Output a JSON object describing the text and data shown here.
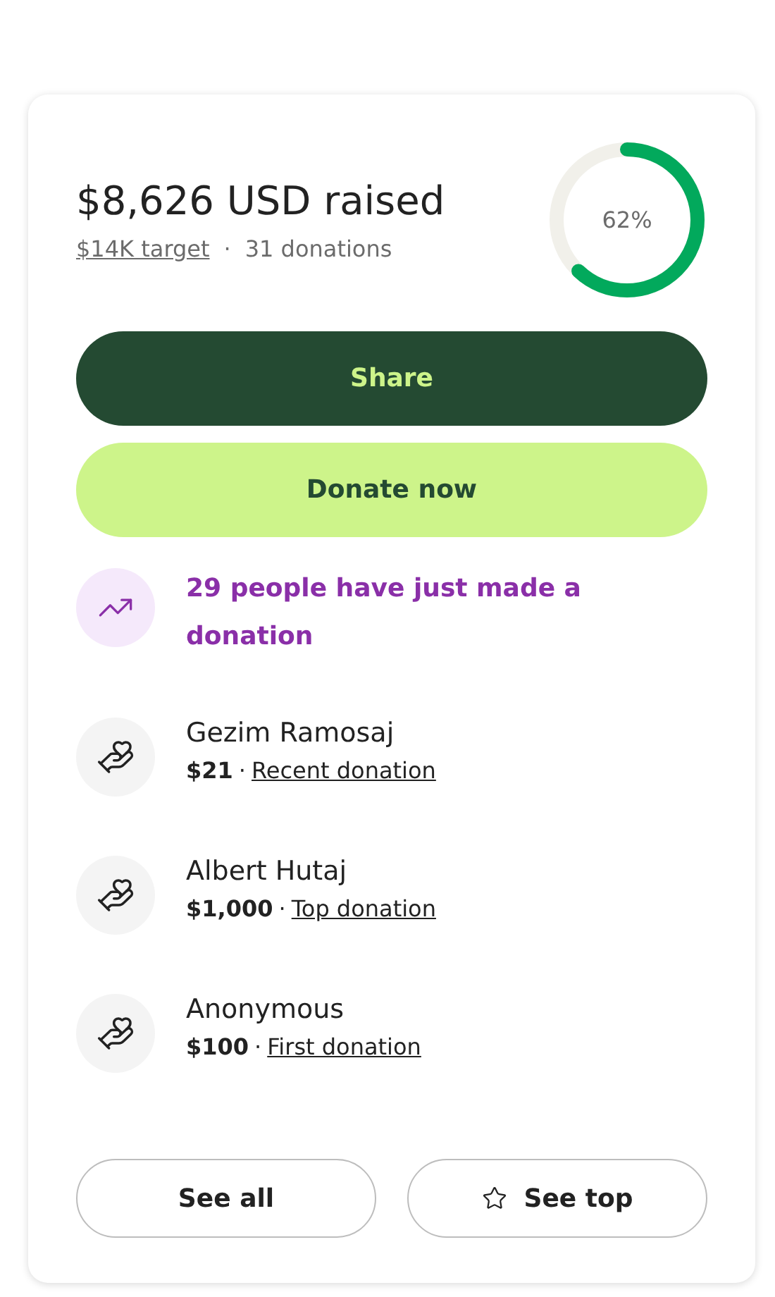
{
  "summary": {
    "raised": "$8,626 USD raised",
    "target": "$14K target",
    "separator": "·",
    "donations": "31 donations",
    "progress": {
      "label": "62%"
    }
  },
  "actions": [
    {
      "kind": "primary",
      "label": "Share"
    },
    {
      "kind": "accent",
      "label": "Donate now"
    }
  ],
  "trend": {
    "text": "29 people have just made a donation"
  },
  "donors": [
    {
      "name": "Gezim Ramosaj",
      "amount": "$21",
      "separator": "·",
      "tag": "Recent donation"
    },
    {
      "name": "Albert Hutaj",
      "amount": "$1,000",
      "separator": "·",
      "tag": "Top donation"
    },
    {
      "name": "Anonymous",
      "amount": "$100",
      "separator": "·",
      "tag": "First donation"
    }
  ],
  "footer_buttons": [
    {
      "label": "See all",
      "kind": "plain"
    },
    {
      "label": "See top",
      "kind": "star"
    }
  ]
}
